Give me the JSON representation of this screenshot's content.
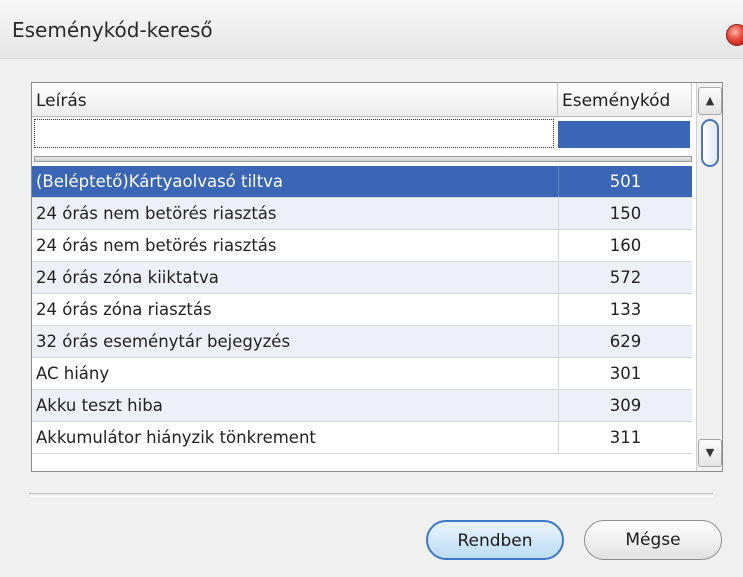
{
  "window": {
    "title": "Eseménykód-kereső"
  },
  "grid": {
    "columns": {
      "description": "Leírás",
      "code": "Eseménykód"
    },
    "filter": {
      "description_value": "",
      "code_value": ""
    },
    "rows": [
      {
        "description": "(Beléptető)Kártyaolvasó  tiltva",
        "code": "501",
        "selected": true
      },
      {
        "description": "24 órás nem betörés riasztás",
        "code": "150"
      },
      {
        "description": "24 órás nem betörés riasztás",
        "code": "160"
      },
      {
        "description": "24 órás zóna kiiktatva",
        "code": "572"
      },
      {
        "description": "24 órás zóna riasztás",
        "code": "133"
      },
      {
        "description": "32 órás eseménytár bejegyzés",
        "code": "629"
      },
      {
        "description": "AC hiány",
        "code": "301"
      },
      {
        "description": "Akku teszt hiba",
        "code": "309"
      },
      {
        "description": "Akkumulátor hiányzik tönkrement",
        "code": "311"
      }
    ]
  },
  "buttons": {
    "ok": "Rendben",
    "cancel": "Mégse"
  },
  "colors": {
    "selection": "#3a66b5",
    "alt_row": "#eef0f7",
    "button_accent": "#3d78c8"
  },
  "icons": {
    "scroll_up": "triangle-up",
    "scroll_down": "triangle-down",
    "close": "red-orb"
  }
}
